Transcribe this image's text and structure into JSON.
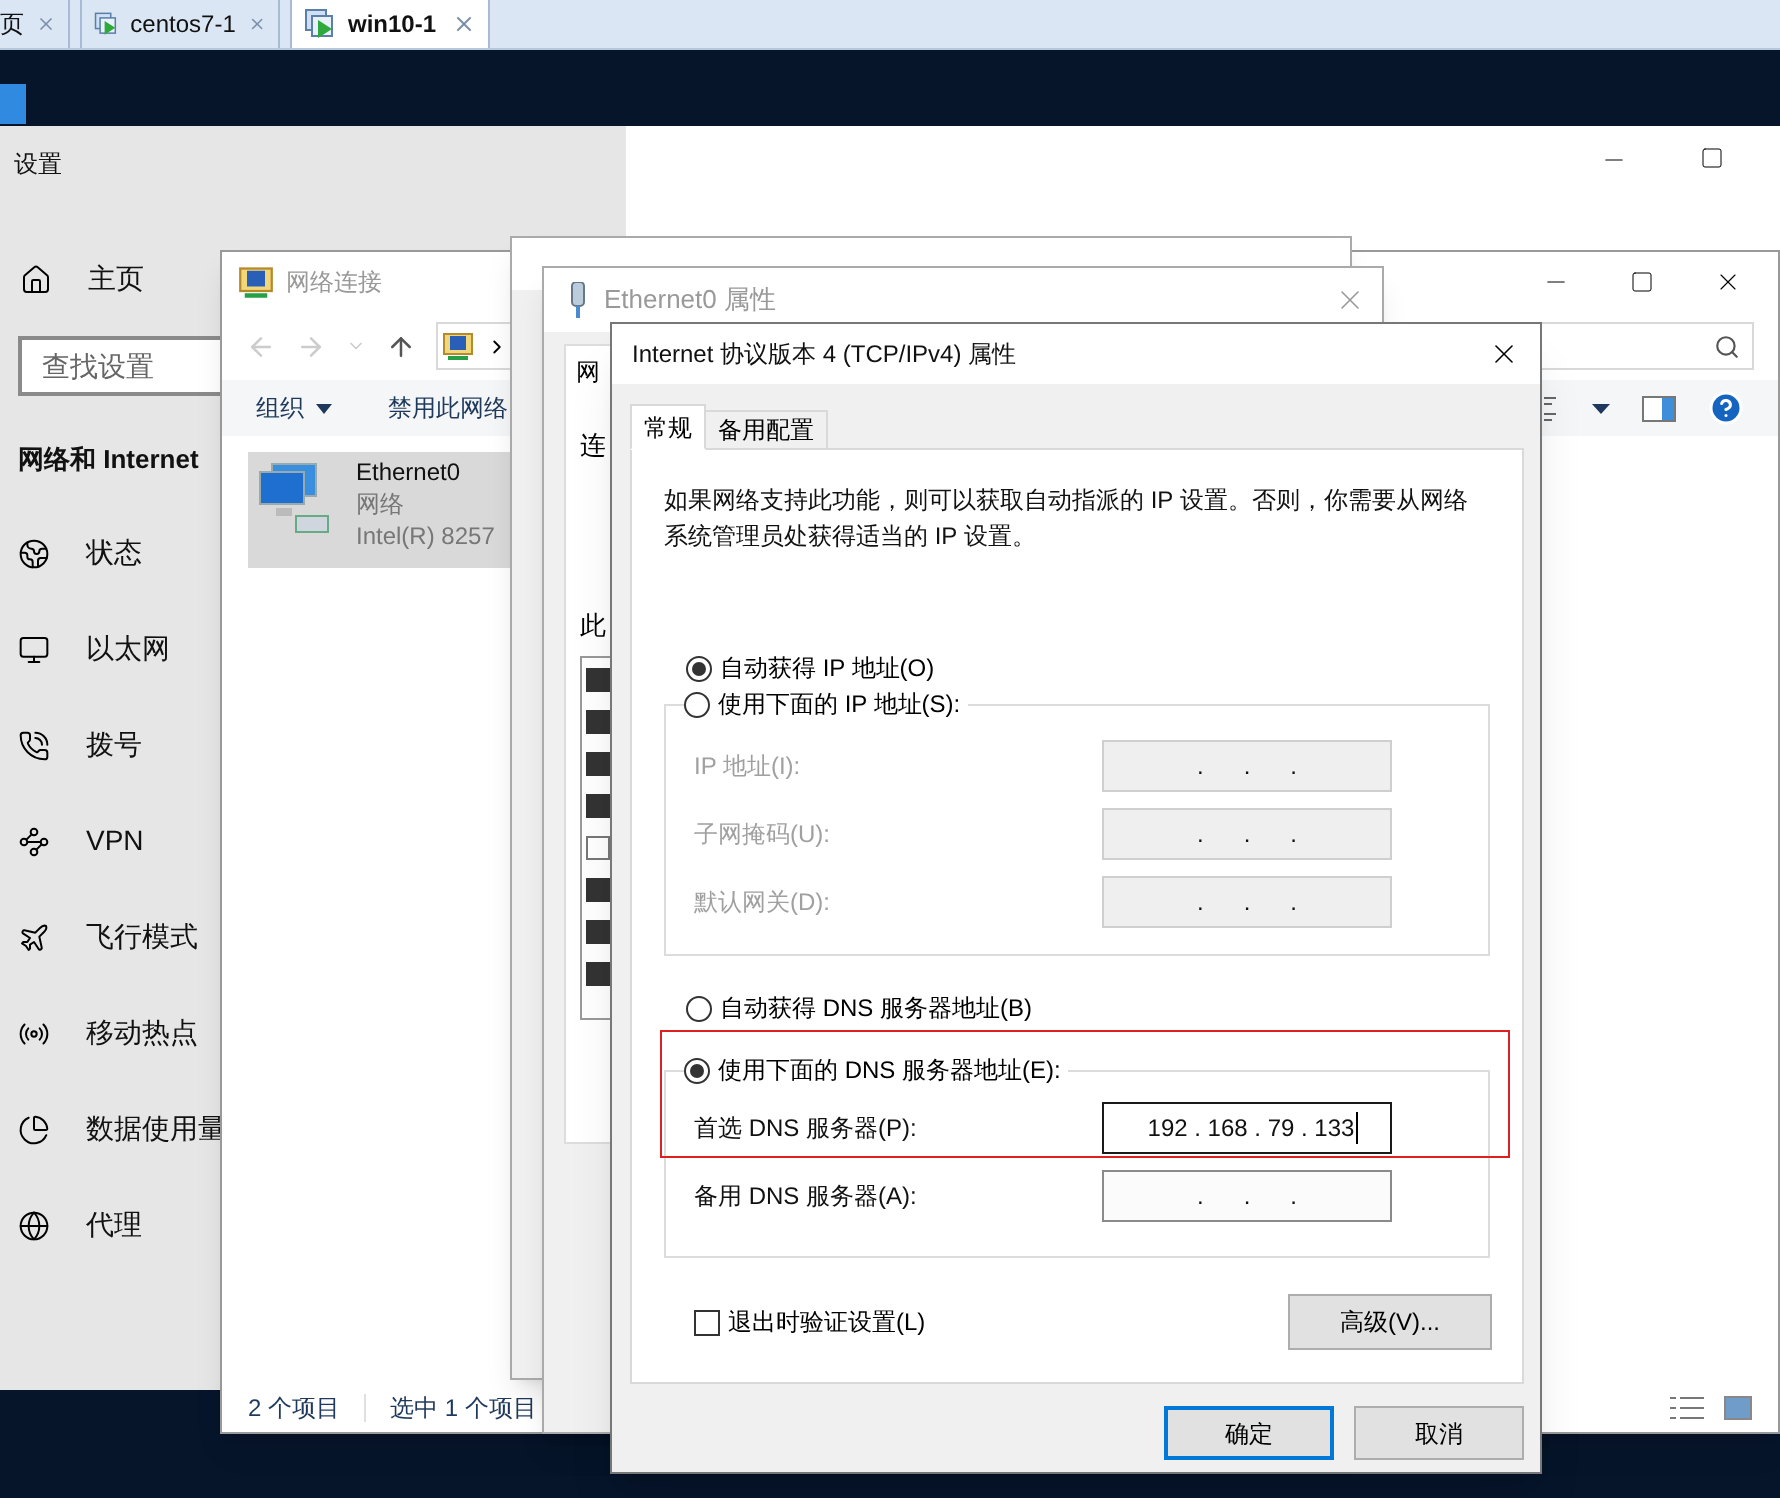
{
  "vm_tabs": [
    {
      "label": "页",
      "selected": false
    },
    {
      "label": "centos7-1",
      "selected": false
    },
    {
      "label": "win10-1",
      "selected": true
    }
  ],
  "settings": {
    "title": "设置",
    "home": "主页",
    "search": {
      "placeholder": "查找设置"
    },
    "section": "网络和 Internet",
    "items": [
      {
        "label": "状态",
        "kind": "status"
      },
      {
        "label": "以太网",
        "kind": "ethernet"
      },
      {
        "label": "拨号",
        "kind": "dialup"
      },
      {
        "label": "VPN",
        "kind": "vpn"
      },
      {
        "label": "飞行模式",
        "kind": "airplane"
      },
      {
        "label": "移动热点",
        "kind": "hotspot"
      },
      {
        "label": "数据使用量",
        "kind": "data"
      },
      {
        "label": "代理",
        "kind": "proxy"
      }
    ]
  },
  "explorer": {
    "title": "网络连接",
    "toolbar": [
      {
        "label": "组织",
        "dropdown": true
      },
      {
        "label": "禁用此网络",
        "dropdown": false
      }
    ],
    "item": {
      "name": "Ethernet0",
      "line_2": "网络",
      "line_3": "Intel(R) 8257",
      "selected": true
    },
    "status_bar": [
      "2 个项目",
      "选中 1 个项目"
    ]
  },
  "status_window": {
    "kind": "window"
  },
  "properties_window": {
    "title": "Ethernet0 属性",
    "tab": "网",
    "label_1": "连",
    "label_2": "此",
    "components": [
      {
        "checked": true
      },
      {
        "checked": true
      },
      {
        "checked": true
      },
      {
        "checked": true
      },
      {
        "checked": false
      },
      {
        "checked": true
      },
      {
        "checked": true
      },
      {
        "checked": true
      }
    ]
  },
  "dialog": {
    "title": "Internet 协议版本 4 (TCP/IPv4) 属性",
    "tabs": [
      {
        "label": "常规",
        "selected": true
      },
      {
        "label": "备用配置",
        "selected": false
      }
    ],
    "description": "如果网络支持此功能，则可以获取自动指派的 IP 设置。否则，你需要从网络系统管理员处获得适当的 IP 设置。",
    "ip_auto": {
      "label": "自动获得 IP 地址(O)",
      "selected": true
    },
    "ip_manual": {
      "label": "使用下面的 IP 地址(S):",
      "selected": false
    },
    "ip_fields": [
      {
        "label": "IP 地址(I):",
        "value": ".      .      .",
        "disabled": true,
        "focused": false
      },
      {
        "label": "子网掩码(U):",
        "value": ".      .      .",
        "disabled": true,
        "focused": false
      },
      {
        "label": "默认网关(D):",
        "value": ".      .      .",
        "disabled": true,
        "focused": false
      }
    ],
    "dns_auto": {
      "label": "自动获得 DNS 服务器地址(B)",
      "selected": false
    },
    "dns_manual": {
      "label": "使用下面的 DNS 服务器地址(E):",
      "selected": true
    },
    "dns_fields": [
      {
        "label": "首选 DNS 服务器(P):",
        "value": "192 . 168 . 79 . 133",
        "disabled": false,
        "focused": true
      },
      {
        "label": "备用 DNS 服务器(A):",
        "value": ".      .      .",
        "disabled": false,
        "focused": false
      }
    ],
    "validate": {
      "label": "退出时验证设置(L)",
      "checked": false
    },
    "advanced": "高级(V)...",
    "buttons": [
      {
        "label": "确定",
        "default": true
      },
      {
        "label": "取消",
        "default": false
      }
    ]
  }
}
